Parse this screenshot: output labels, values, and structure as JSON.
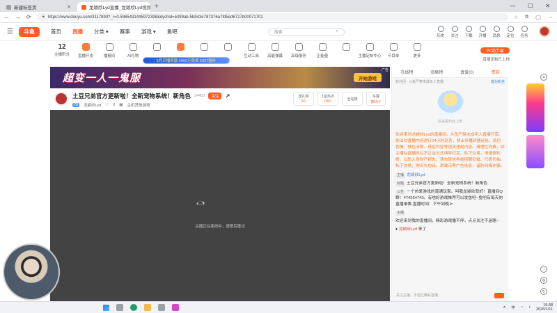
{
  "browser": {
    "tabs": [
      {
        "label": "新建标签页",
        "active": false
      },
      {
        "label": "龙颖欣Lyd直播_龙颖欣Lyd视频_斗鱼直播",
        "active": true
      }
    ],
    "url": "https://www.douyu.com/3117890?_r=0.5965431445972398&dyshid=e399ab-5b943e787376a7fd5ed6727b00071701"
  },
  "header": {
    "logo": "斗鱼",
    "nav": [
      {
        "label": "首页",
        "active": false
      },
      {
        "label": "直播",
        "active": true
      },
      {
        "label": "分类 ▾",
        "active": false
      },
      {
        "label": "赛事",
        "active": false
      },
      {
        "label": "游戏 ▾",
        "active": false
      },
      {
        "label": "鱼吧",
        "active": false
      }
    ],
    "search_placeholder": "搜索",
    "actions": [
      "历史",
      "关注",
      "下载",
      "开播",
      "消息",
      "定位",
      "任务"
    ]
  },
  "toolbar": {
    "score_value": "12",
    "score_label": "主播积分",
    "badge": "2",
    "items": [
      "直播开支",
      "播报间",
      "AI礼物",
      "",
      "",
      "",
      "",
      "互动工具",
      "高能弹幕",
      "高级服务",
      "正能量",
      "",
      "主播定制中心",
      "节目单",
      "更多"
    ],
    "pc_button": "PC助手端",
    "pc_sub": "直播定制已上线",
    "promo": "5月开播奖励 5000万免费 5007额外"
  },
  "ad": {
    "title": "超变一人一鬼服",
    "button": "开始游戏",
    "tag": "广告"
  },
  "room": {
    "title": "土豆兄弟官方更新啦！全新宠物系统！新角色",
    "hot": "34403",
    "follow": "关注",
    "level": "70",
    "streamer": "龙颖欣Lyd",
    "likes": "0",
    "category": "主机其他游戏",
    "boxes": [
      {
        "label": "送礼物",
        "value": "0/1"
      },
      {
        "label": "1星热点",
        "value": "0/60"
      },
      {
        "label": "全站榜",
        "value": ""
      },
      {
        "label": "车展",
        "value": "第10个"
      }
    ]
  },
  "video": {
    "message": "主播正在连线中，请稍后重试"
  },
  "chat": {
    "tabs": [
      {
        "label": "在线榜",
        "active": false
      },
      {
        "label": "贡献榜",
        "active": false
      },
      {
        "label": "真爱(0)",
        "active": false
      },
      {
        "label": "贵族",
        "active": true
      }
    ],
    "rank_left": "粉丝团",
    "rank_text": "斗鱼严禁未成年人直播",
    "rank_right": "成为粉丝",
    "empty_text": "还来看粉丝上榜",
    "system_msg": "欢迎来到龙颖欣Lyd的直播间。斗鱼严禁未成年人直播打赏。依法对直播内容进行24小时巡查，禁止传播封建迷信、低俗色情、低俗涉黄、低俗内容等违法违规内容。请理性消费，如主播在直播时以不正当方式诱导打赏、私下交易，请谨慎判断，以防人身财产损失。请勿轻信各类招聘征婚、代练代抽、私下交易、购买礼包码、游戏币等广告信息，谨防网络诈骗。",
    "messages": [
      {
        "tag": "主播",
        "user": "龙颖欣Lyd",
        "text": ""
      },
      {
        "tag": "标题",
        "user": "",
        "text": "土豆兄弟官方更新啦！全新宠物系统！新角色"
      },
      {
        "tag": "公告",
        "user": "",
        "text": "一个热爱游戏的普通玩家。叫我龙颖欣就好！直播间Q群：474264743。有啥好游戏推荐可以发鱼吧~鱼吧有每天的直播录像 直播时间：下午到晚上"
      },
      {
        "tag": "主播",
        "user": "",
        "text": ""
      },
      {
        "tag": "",
        "user": "",
        "text": "欢迎来到我的直播间，精彩游戏播不停，点点关注不迷路~"
      },
      {
        "tag": "",
        "user": "龙颖欣Lyd",
        "text": "来了"
      }
    ],
    "input_placeholder": "关注主播，不错过精彩直播"
  },
  "taskbar": {
    "time": "19:38",
    "date": "2026/1/11",
    "lang": "中"
  }
}
